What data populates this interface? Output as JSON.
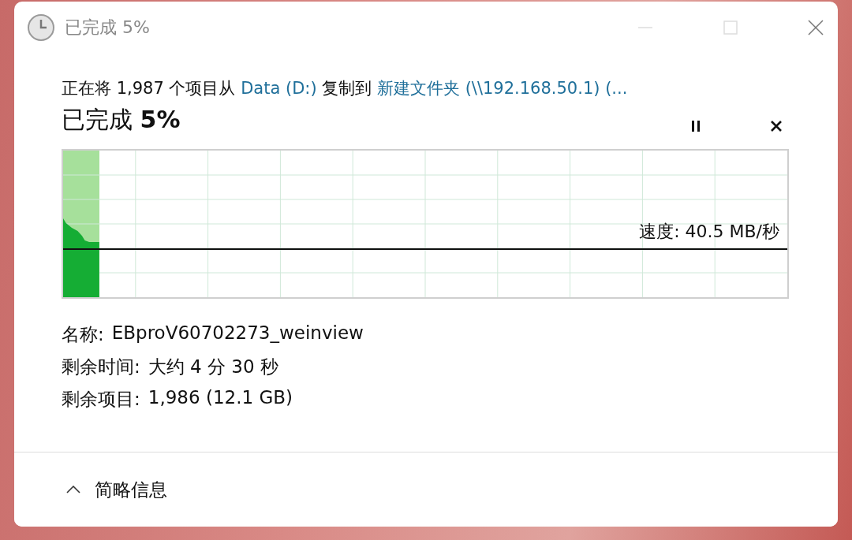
{
  "window": {
    "title": "已完成 5%"
  },
  "copy_info": [
    {
      "kind": "plain",
      "text": "正在将 1,987 个项目从 "
    },
    {
      "kind": "link",
      "text": "Data (D:)"
    },
    {
      "kind": "plain",
      "text": " 复制到 "
    },
    {
      "kind": "link",
      "text": "新建文件夹 (\\\\192.168.50.1) (..."
    }
  ],
  "progress": {
    "label": "已完成 **5%**",
    "level": 0.05
  },
  "graph": {
    "speed": "速度: 40.5 MB/秒"
  },
  "details": [
    {
      "label": "名称:",
      "value": "EBproV60702273_weinview"
    },
    {
      "label": "剩余时间:",
      "value": "大约 4 分 30 秒"
    },
    {
      "label": "剩余项目:",
      "value": "1,986 (12.1 GB)"
    }
  ],
  "footer": {
    "label": "简略信息",
    "expanded": true
  }
}
